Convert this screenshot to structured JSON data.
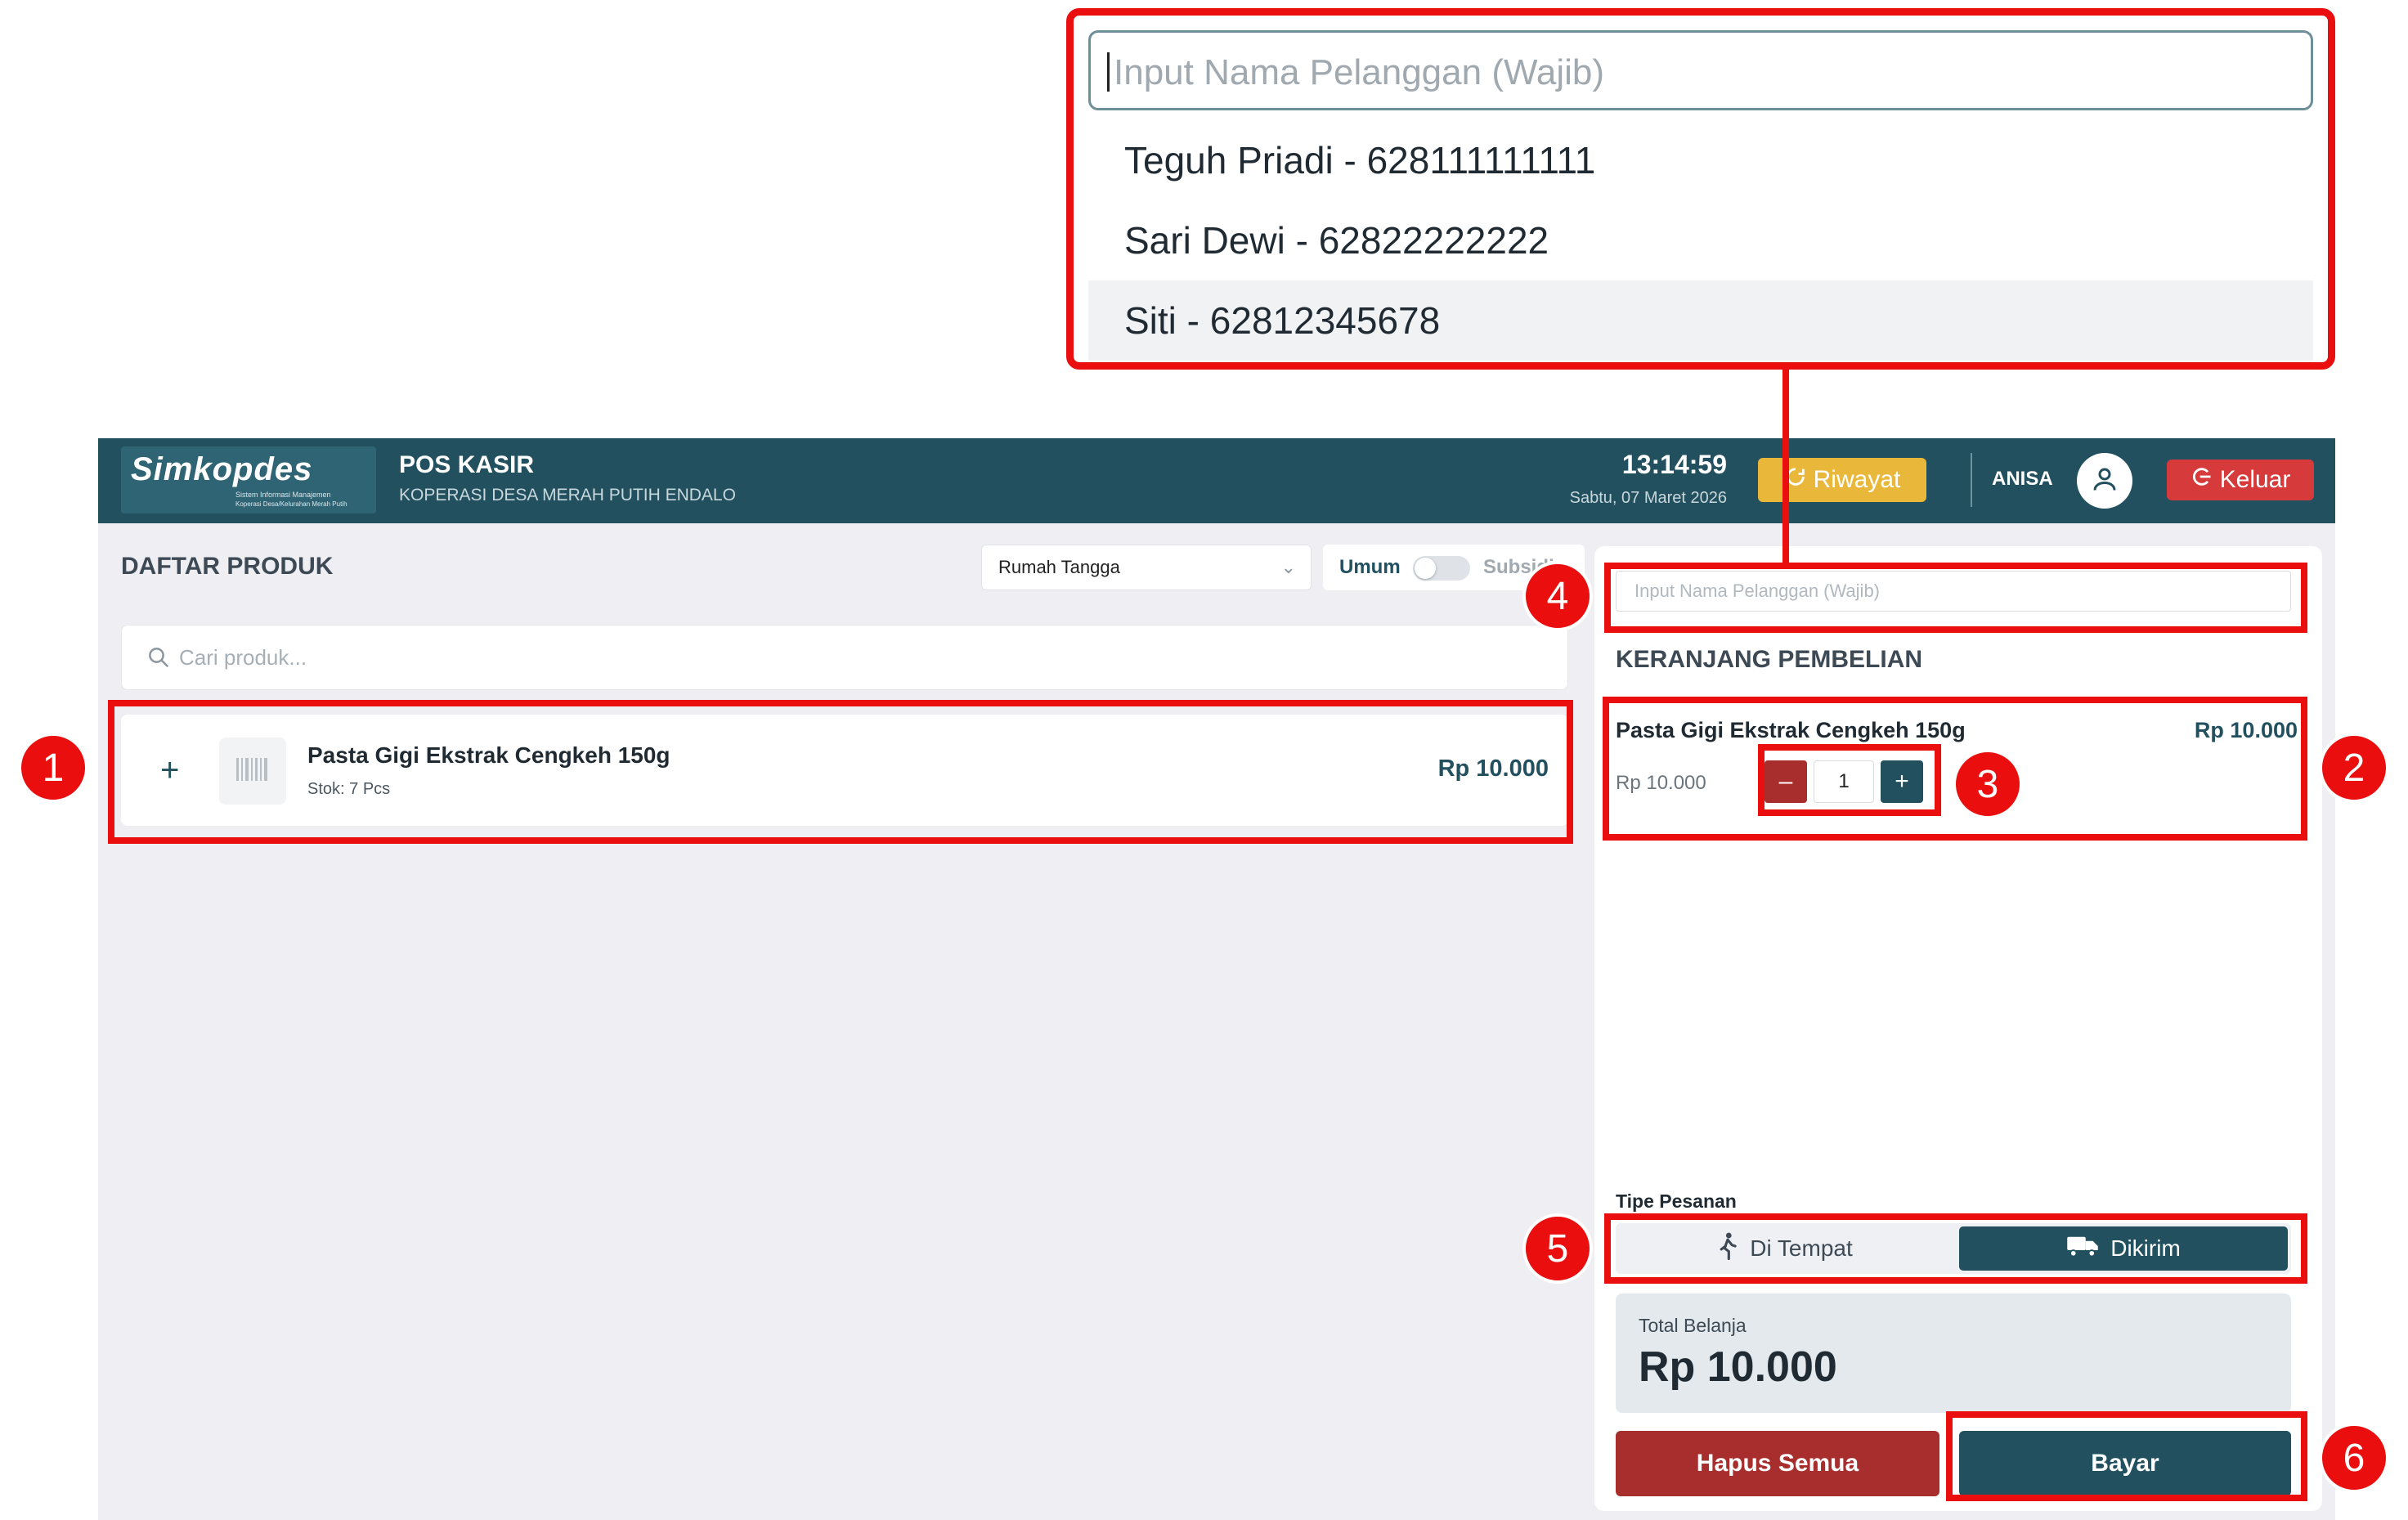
{
  "header": {
    "logo_text": "Simkopdes",
    "logo_sub1": "Sistem Informasi Manajemen",
    "logo_sub2": "Koperasi Desa/Kelurahan Merah Putih",
    "title": "POS KASIR",
    "subtitle": "KOPERASI DESA MERAH PUTIH ENDALO",
    "time": "13:14:59",
    "date": "Sabtu, 07 Maret 2026",
    "riwayat_label": "Riwayat",
    "user_name": "ANISA",
    "keluar_label": "Keluar"
  },
  "products": {
    "title": "DAFTAR PRODUK",
    "category_selected": "Rumah Tangga",
    "toggle_left": "Umum",
    "toggle_right": "Subsidi",
    "search_placeholder": "Cari produk...",
    "items": [
      {
        "name": "Pasta Gigi Ekstrak Cengkeh 150g",
        "stock": "Stok: 7 Pcs",
        "price": "Rp 10.000"
      }
    ]
  },
  "cart": {
    "customer_placeholder": "Input Nama Pelanggan (Wajib)",
    "title": "KERANJANG PEMBELIAN",
    "items": [
      {
        "name": "Pasta Gigi Ekstrak Cengkeh 150g",
        "unit_price": "Rp 10.000",
        "qty": "1",
        "subtotal": "Rp 10.000"
      }
    ],
    "order_type_label": "Tipe Pesanan",
    "order_types": [
      "Di Tempat",
      "Dikirim"
    ],
    "order_type_selected": "Dikirim",
    "total_label": "Total Belanja",
    "total_value": "Rp 10.000",
    "clear_label": "Hapus Semua",
    "pay_label": "Bayar"
  },
  "customer_dropdown": {
    "placeholder": "Input Nama Pelanggan (Wajib)",
    "options": [
      "Teguh Priadi - 628111111111",
      "Sari Dewi - 62822222222",
      "Siti - 62812345678"
    ]
  },
  "annotations": [
    "1",
    "2",
    "3",
    "4",
    "5",
    "6"
  ],
  "colors": {
    "brand": "#22505f",
    "danger": "#a82d2d",
    "accent_yellow": "#e9b83a",
    "highlight": "#ea0e0e"
  }
}
